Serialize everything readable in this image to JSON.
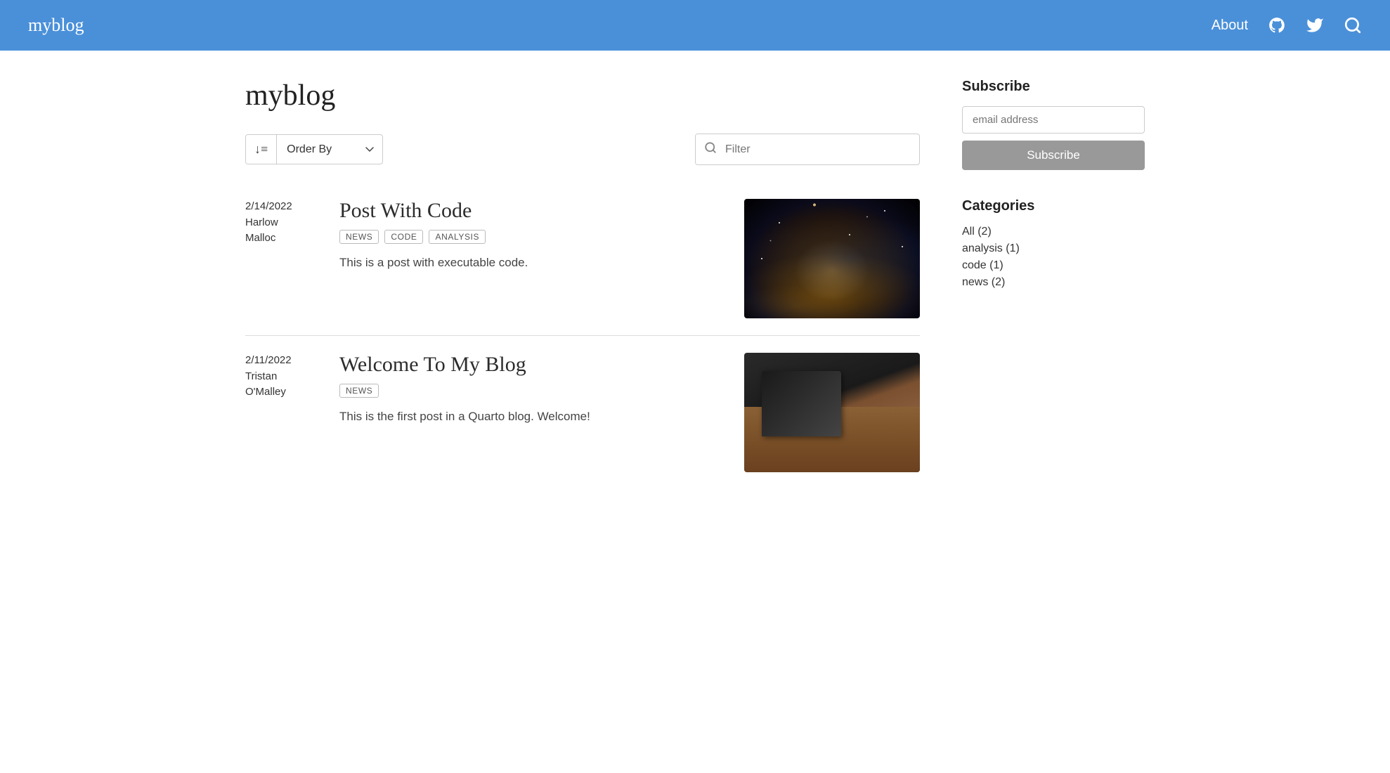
{
  "header": {
    "brand": "myblog",
    "nav": {
      "about_label": "About",
      "github_title": "GitHub",
      "twitter_title": "Twitter",
      "search_title": "Search"
    }
  },
  "main": {
    "page_title": "myblog",
    "toolbar": {
      "order_label": "Order By",
      "filter_placeholder": "Filter",
      "sort_icon": "↓≡"
    },
    "posts": [
      {
        "date": "2/14/2022",
        "author_line1": "Harlow",
        "author_line2": "Malloc",
        "title": "Post With Code",
        "tags": [
          "NEWS",
          "CODE",
          "ANALYSIS"
        ],
        "excerpt": "This is a post with executable code.",
        "image_type": "space"
      },
      {
        "date": "2/11/2022",
        "author_line1": "Tristan",
        "author_line2": "O'Malley",
        "title": "Welcome To My Blog",
        "tags": [
          "NEWS"
        ],
        "excerpt": "This is the first post in a Quarto blog. Welcome!",
        "image_type": "desk"
      }
    ]
  },
  "sidebar": {
    "subscribe_heading": "Subscribe",
    "email_placeholder": "email address",
    "subscribe_btn_label": "Subscribe",
    "categories_heading": "Categories",
    "categories": [
      {
        "label": "All (2)"
      },
      {
        "label": "analysis (1)"
      },
      {
        "label": "code (1)"
      },
      {
        "label": "news (2)"
      }
    ]
  }
}
